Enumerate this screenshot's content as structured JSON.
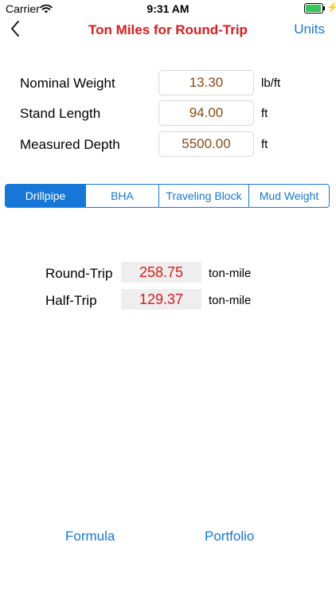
{
  "status_bar": {
    "carrier": "Carrier",
    "time": "9:31 AM",
    "battery_color": "#34c759"
  },
  "nav": {
    "back_icon": "chevron-left-icon",
    "title": "Ton Miles for Round-Trip",
    "title_color": "#e0191b",
    "units_label": "Units"
  },
  "inputs": [
    {
      "label": "Nominal Weight",
      "value": "13.30",
      "unit": "lb/ft"
    },
    {
      "label": "Stand Length",
      "value": "94.00",
      "unit": "ft"
    },
    {
      "label": "Measured Depth",
      "value": "5500.00",
      "unit": "ft"
    }
  ],
  "segmented_control": {
    "selected": "Drillpipe",
    "segments": [
      "Drillpipe",
      "BHA",
      "Traveling Block",
      "Mud Weight"
    ],
    "accent": "#1677d8"
  },
  "results": [
    {
      "label": "Round-Trip",
      "value": "258.75",
      "unit": "ton-mile"
    },
    {
      "label": "Half-Trip",
      "value": "129.37",
      "unit": "ton-mile"
    }
  ],
  "bottom": {
    "formula_label": "Formula",
    "portfolio_label": "Portfolio"
  }
}
